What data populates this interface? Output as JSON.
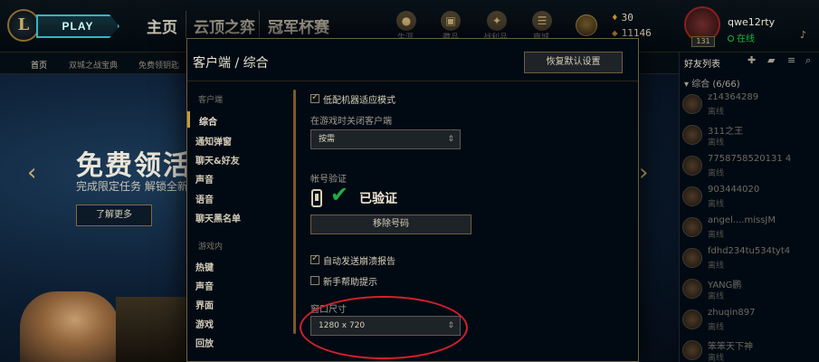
{
  "topbar": {
    "logo": "L",
    "play": "PLAY",
    "tabs": [
      "主页",
      "云顶之弈",
      "冠军杯赛"
    ],
    "icons": [
      {
        "name": "profile-icon",
        "glyph": "●",
        "label": "生涯"
      },
      {
        "name": "collection-icon",
        "glyph": "▣",
        "label": "藏品"
      },
      {
        "name": "loot-icon",
        "glyph": "✦",
        "label": "战利品"
      },
      {
        "name": "store-icon",
        "glyph": "☰",
        "label": "商城"
      }
    ],
    "blue_essence": "30",
    "riot_points": "11146",
    "summoner_name": "qwe12rty",
    "summoner_status": "在线",
    "level": "131",
    "bell_glyph": "♪"
  },
  "subnav": [
    "首页",
    "双城之战宝典",
    "免费领钥匙"
  ],
  "banner": {
    "title": "免费领活",
    "subtitle": "完成限定任务 解锁全新",
    "button": "了解更多"
  },
  "modal": {
    "title": "客户端 / 综合",
    "restore_button": "恢复默认设置",
    "sidebar": {
      "client_header": "客户端",
      "client_items": [
        "综合",
        "通知弹窗",
        "聊天&好友",
        "声音",
        "语音",
        "聊天黑名单"
      ],
      "game_header": "游戏内",
      "game_items": [
        "热键",
        "声音",
        "界面",
        "游戏",
        "回放"
      ]
    },
    "low_spec_mode": "低配机器适应模式",
    "close_client_label": "在游戏时关闭客户端",
    "close_client_value": "按需",
    "account_verify_label": "帐号验证",
    "verified_text": "已验证",
    "remove_phone_button": "移除号码",
    "auto_send_crash": "自动发送崩溃报告",
    "new_player_tips": "新手帮助提示",
    "window_size_label": "窗口尺寸",
    "window_size_value": "1280 x 720"
  },
  "friends": {
    "title": "好友列表",
    "group": "综合 (6/66)",
    "status_offline": "离线",
    "list": [
      {
        "name": "z14364289",
        "status": "离线"
      },
      {
        "name": "311之王",
        "status": "离线"
      },
      {
        "name": "7758758520131 4",
        "status": "离线"
      },
      {
        "name": "903444020",
        "status": "离线"
      },
      {
        "name": "angel....missJM",
        "status": "离线"
      },
      {
        "name": "fdhd234tu534tyt4",
        "status": "离线"
      },
      {
        "name": "YANG鹏",
        "status": "离线"
      },
      {
        "name": "zhuqin897",
        "status": "离线"
      },
      {
        "name": "笨笨天下神",
        "status": "离线"
      }
    ]
  },
  "colors": {
    "gold": "#c89b3c",
    "teal": "#2fb7c5",
    "online_green": "#19b33f",
    "verified_green": "#1fae45",
    "highlight_red": "#d61f2c"
  }
}
